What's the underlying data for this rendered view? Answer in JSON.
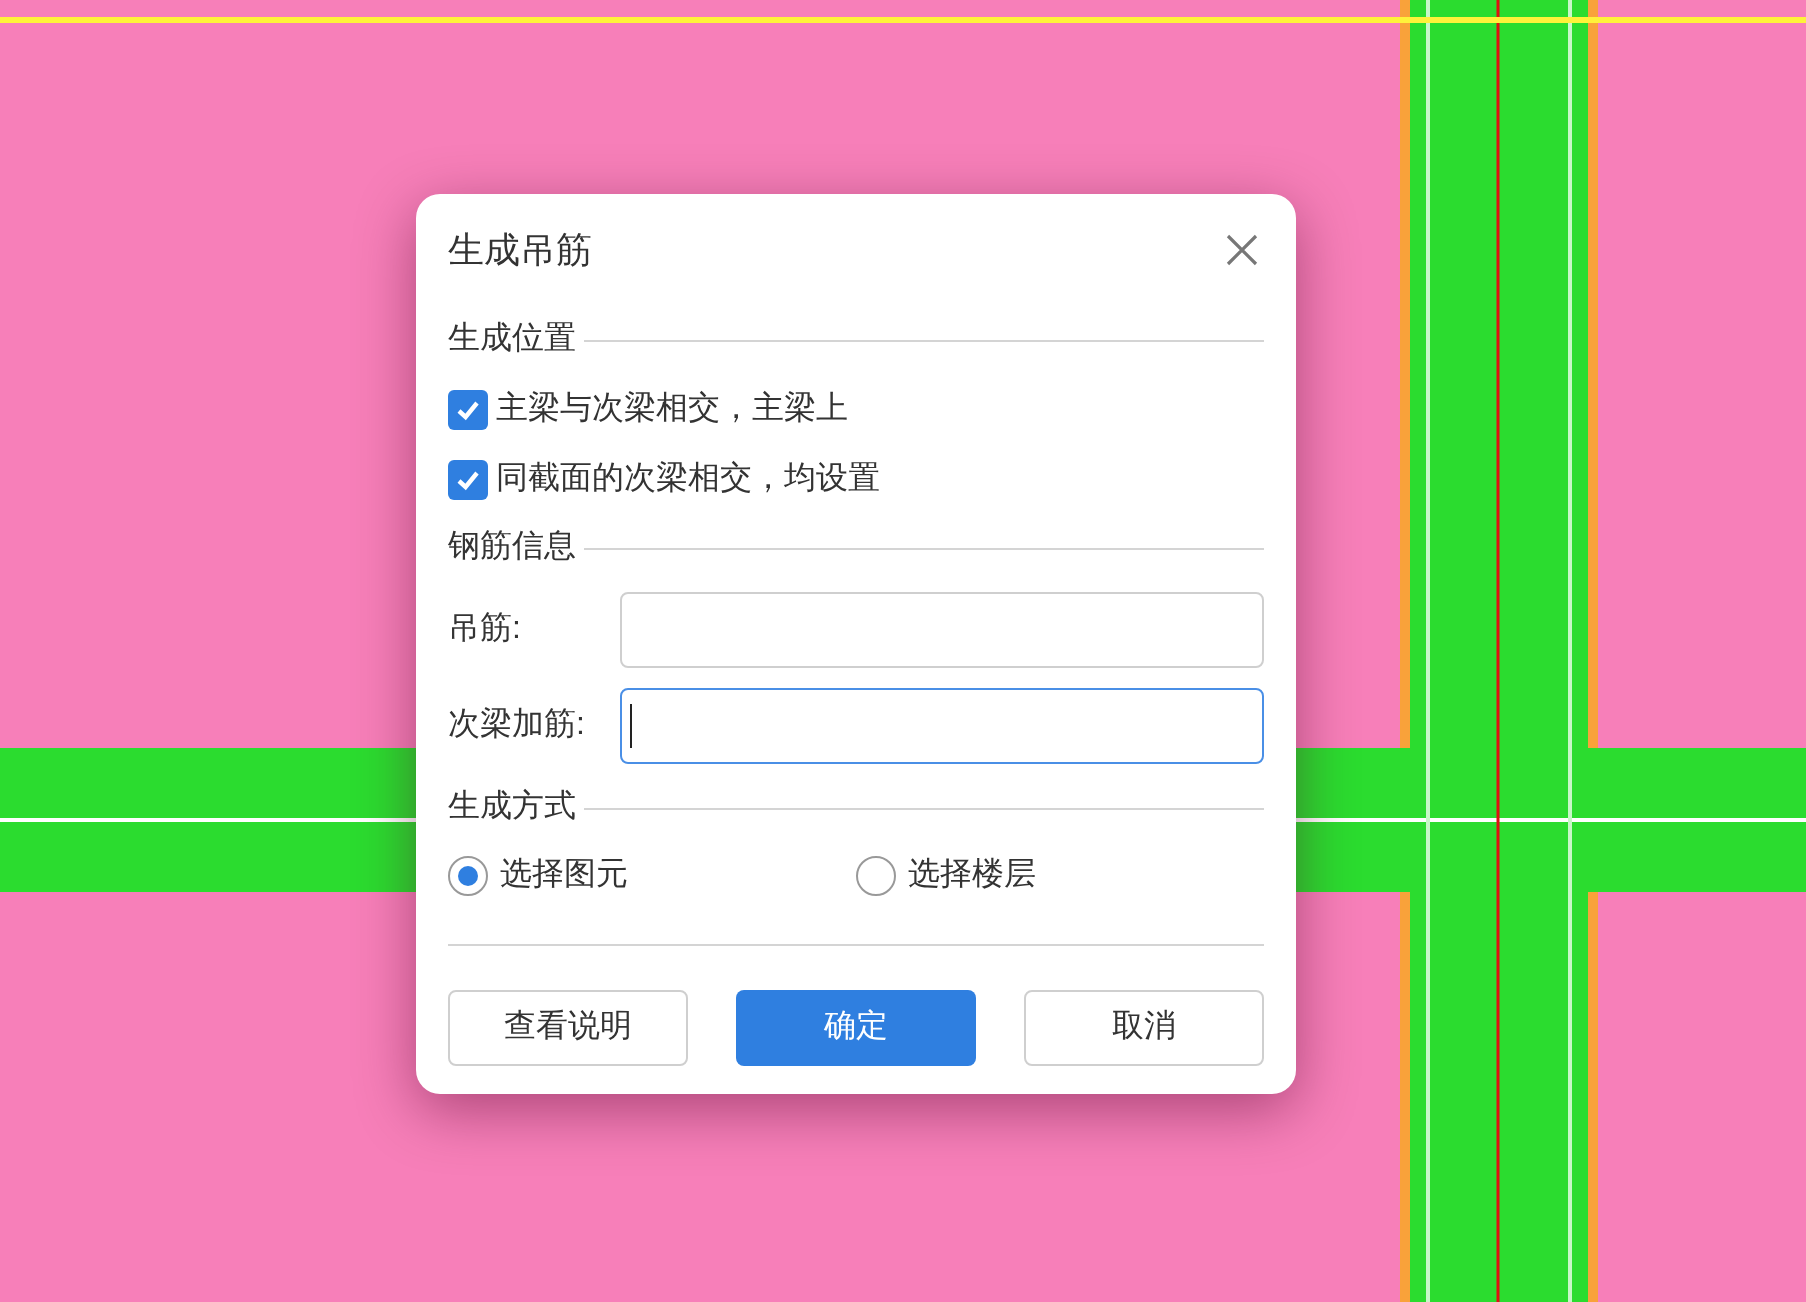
{
  "dialog": {
    "title": "生成吊筋",
    "sections": [
      {
        "kind": "checks",
        "title": "生成位置",
        "items": [
          {
            "label": "主梁与次梁相交，主梁上",
            "checked": true
          },
          {
            "label": "同截面的次梁相交，均设置",
            "checked": true
          }
        ]
      },
      {
        "kind": "fields",
        "title": "钢筋信息",
        "items": [
          {
            "label": "吊筋:",
            "focused": false
          },
          {
            "label": "次梁加筋:",
            "focused": true
          }
        ]
      },
      {
        "kind": "radios",
        "title": "生成方式",
        "items": [
          {
            "label": "选择图元",
            "selected": true
          },
          {
            "label": "选择楼层",
            "selected": false
          }
        ]
      }
    ],
    "buttons": [
      {
        "label": "查看说明",
        "primary": false
      },
      {
        "label": "确定",
        "primary": true
      },
      {
        "label": "取消",
        "primary": false
      }
    ]
  }
}
